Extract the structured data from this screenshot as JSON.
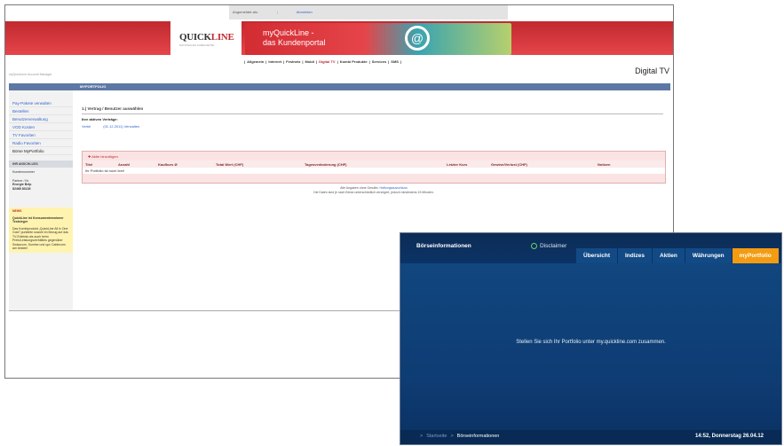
{
  "web": {
    "topbar": {
      "logged_in": "Angemeldet als:",
      "logout": "Abmelden"
    },
    "logo": {
      "text_a": "QUICK",
      "text_b": "LINE",
      "sub": "NATIONALEN          KABELNETZE"
    },
    "portal": {
      "line1": "myQuickLine -",
      "line2": "das Kundenportal",
      "icon": "@"
    },
    "nav": [
      {
        "label": "Allgemein",
        "active": false
      },
      {
        "label": "Internet",
        "active": false
      },
      {
        "label": "Festnetz",
        "active": false
      },
      {
        "label": "Mobil",
        "active": false
      },
      {
        "label": "Digital TV",
        "active": true
      },
      {
        "label": "Kombi Produkte",
        "active": false
      },
      {
        "label": "Services",
        "active": false
      },
      {
        "label": "SMS",
        "active": false
      }
    ],
    "account_manager": "myQuickLine Account Manager",
    "section_title": "Digital TV",
    "header_bar": "MYPORTFOLIO",
    "sidebar": {
      "items": [
        "Pay-Pakete verwalten",
        "Bestellen",
        "Benutzerverwaltung",
        "VOD Kosten",
        "TV Favoriten",
        "Radio Favoriten",
        "Börse MyPortfolio"
      ],
      "anschluss_header": "IHR ANSCHLUSS",
      "kundennummer": "Kundennummer",
      "partner_label": "Partner / Nr.",
      "partner_name": "Energie Belp",
      "partner_no": "82468 83138",
      "news_header": "NEWS",
      "news_title": "QuickLine ist Konsumentenwinner",
      "news_title2": "Testsieger",
      "news_text": "Das Kombiprodukt „QuickLine All in One Gold\" punktete sowohl im Bezug auf das TV-Erlebnis als auch beim Preis/Leistungsverhältnis gegenüber Swisscom, Sunrise und upc Cablecom am besten!"
    },
    "main": {
      "step": "1.) Vertrag / Benutzer auswählen",
      "vertraege_label": "Ihre aktiven Verträge:",
      "vertrag_name": "Vertel",
      "vertrag_date": "(01.12.2011) Verwalten",
      "add_label": "Aktie hinzufügen",
      "columns": [
        "Titel",
        "Anzahl",
        "Kaufkurs Ø",
        "Total Wert (CHF)",
        "Tagesveränderung (CHF)",
        "Letzter Kurs",
        "Gewinn/Verlust (CHF)",
        "Notizen"
      ],
      "empty": "Ihr Portfolio ist noch leer!",
      "note1": "Alle Angaben ohne Gewähr.",
      "note1_link": "Haftungsausschluss",
      "note2": "Die Daten sind je nach Börse unterschiedlich verzögert, jedoch mindestens 15 Minuten."
    }
  },
  "tv": {
    "title": "Börseinformationen",
    "disclaimer": "Disclaimer",
    "tabs": [
      {
        "label": "Übersicht",
        "active": false
      },
      {
        "label": "Indizes",
        "active": false
      },
      {
        "label": "Aktien",
        "active": false
      },
      {
        "label": "Währungen",
        "active": false
      },
      {
        "label": "myPortfolio",
        "active": true
      }
    ],
    "message": "Stellen Sie sich Ihr Portfolio unter my.quickline.com zusammen.",
    "breadcrumb_home": "Startseite",
    "breadcrumb_current": "Börseinformationen",
    "time": "14:52, Donnerstag 26.04.12"
  }
}
